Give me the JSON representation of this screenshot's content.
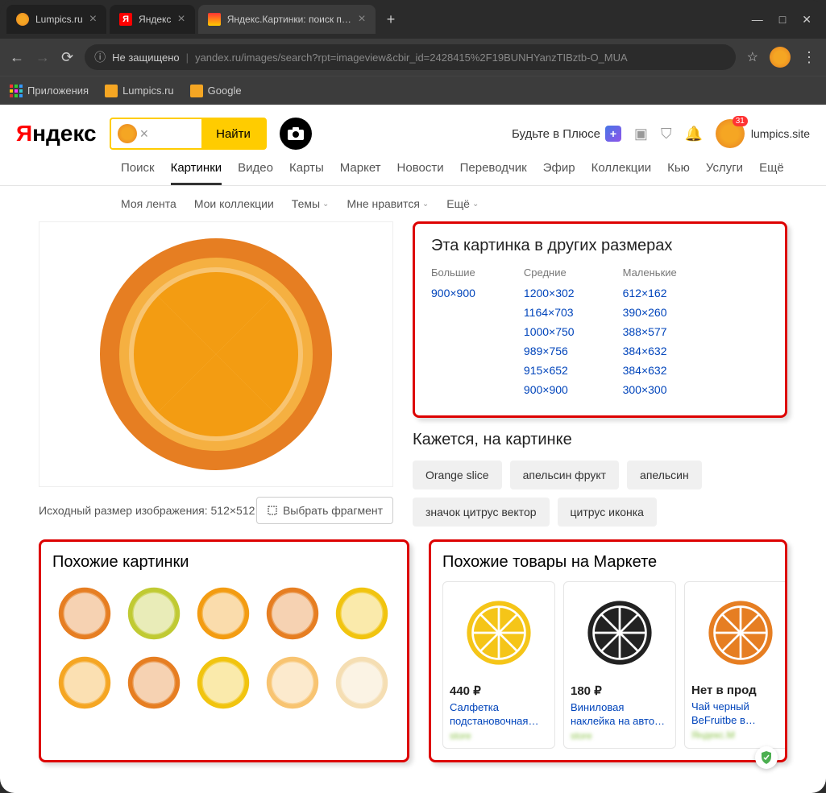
{
  "browser": {
    "tabs": [
      {
        "title": "Lumpics.ru",
        "favcolor": "#f5a623"
      },
      {
        "title": "Яндекс",
        "favcolor": "#ff0000"
      },
      {
        "title": "Яндекс.Картинки: поиск по кар",
        "favcolor": "#ffcc00"
      }
    ],
    "security_label": "Не защищено",
    "url": "yandex.ru/images/search?rpt=imageview&cbir_id=2428415%2F19BUNHYanzTIBztb-O_MUA",
    "bookmarks": {
      "apps": "Приложения",
      "items": [
        "Lumpics.ru",
        "Google"
      ]
    }
  },
  "yandex": {
    "logo": "Яндекс",
    "search_button": "Найти",
    "plus_label": "Будьте в Плюсе",
    "badge_count": "31",
    "username": "lumpics.site",
    "tabs": [
      "Поиск",
      "Картинки",
      "Видео",
      "Карты",
      "Маркет",
      "Новости",
      "Переводчик",
      "Эфир",
      "Коллекции",
      "Кью",
      "Услуги",
      "Ещё"
    ],
    "active_tab": 1,
    "subtabs": [
      "Моя лента",
      "Мои коллекции",
      "Темы",
      "Мне нравится",
      "Ещё"
    ]
  },
  "image_info": {
    "caption": "Исходный размер изображения: 512×512",
    "crop_button": "Выбрать фрагмент"
  },
  "other_sizes": {
    "title": "Эта картинка в других размерах",
    "big_label": "Большие",
    "med_label": "Средние",
    "small_label": "Маленькие",
    "big": [
      "900×900"
    ],
    "med": [
      "1200×302",
      "1164×703",
      "1000×750",
      "989×756",
      "915×652",
      "900×900"
    ],
    "small": [
      "612×162",
      "390×260",
      "388×577",
      "384×632",
      "384×632",
      "300×300"
    ]
  },
  "seems": {
    "title": "Кажется, на картинке",
    "chips": [
      "Orange slice",
      "апельсин фрукт",
      "апельсин",
      "значок цитрус вектор",
      "цитрус иконка"
    ]
  },
  "similar": {
    "title": "Похожие картинки",
    "count": 10
  },
  "market": {
    "title": "Похожие товары на Маркете",
    "products": [
      {
        "price": "440 ₽",
        "name": "Салфетка подстановочная…",
        "store": "store",
        "color": "#f5c518"
      },
      {
        "price": "180 ₽",
        "name": "Виниловая наклейка на авто…",
        "store": "store",
        "color": "#222"
      },
      {
        "price": "Нет в прод",
        "name": "Чай черный BeFruitbe в…",
        "store": "Яндекс.М",
        "color": "#e67e22"
      }
    ]
  }
}
